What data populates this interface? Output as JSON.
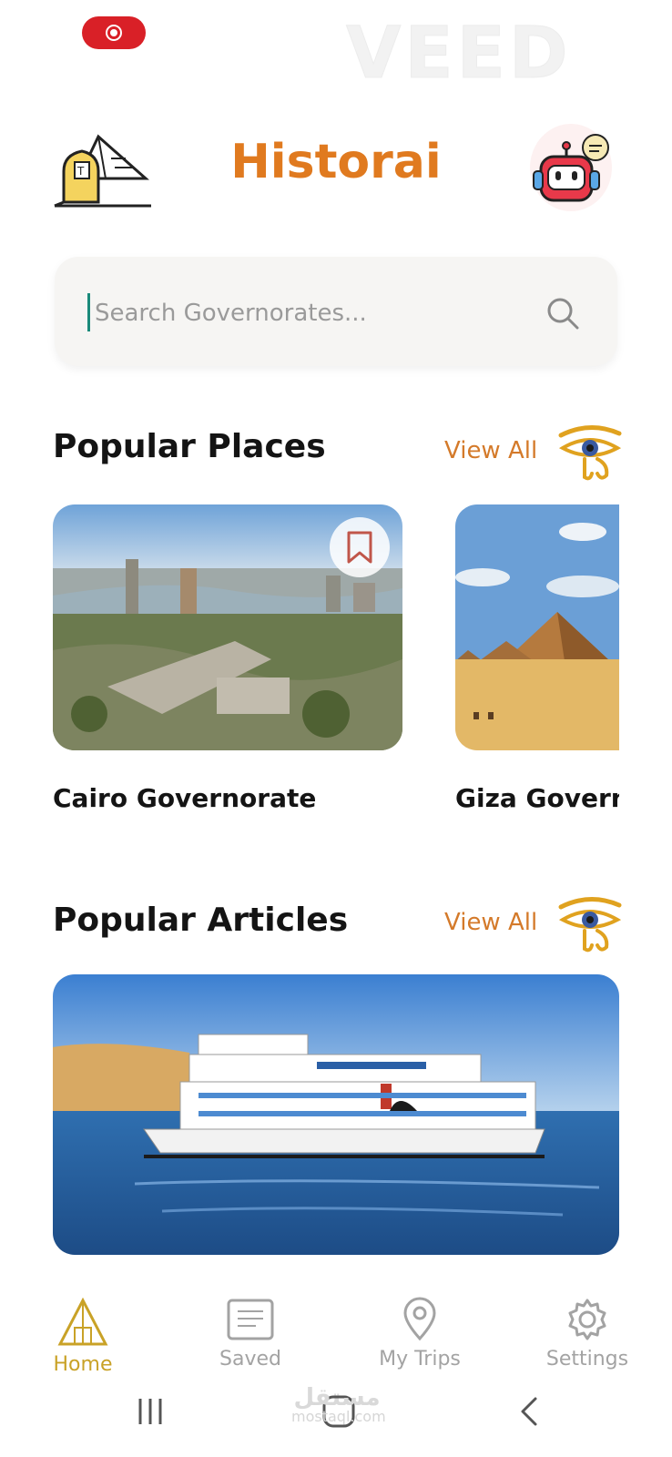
{
  "status": {
    "record_indicator": "recording",
    "watermark": "VEED"
  },
  "header": {
    "title": "Historai",
    "logo_icon": "pyramid-sphinx-icon",
    "assistant_icon": "robot-assistant-icon"
  },
  "search": {
    "placeholder": "Search Governorates..."
  },
  "popular_places": {
    "title": "Popular Places",
    "view_all": "View All",
    "items": [
      {
        "label": "Cairo Governorate",
        "bookmark_icon": "bookmark-icon"
      },
      {
        "label": "Giza Governorate"
      }
    ]
  },
  "popular_articles": {
    "title": "Popular Articles",
    "view_all": "View All"
  },
  "bottom_nav": {
    "items": [
      {
        "label": "Home",
        "icon": "home-pyramid-icon",
        "active": true
      },
      {
        "label": "Saved",
        "icon": "saved-icon",
        "active": false
      },
      {
        "label": "My Trips",
        "icon": "location-pin-icon",
        "active": false
      },
      {
        "label": "Settings",
        "icon": "gear-icon",
        "active": false
      }
    ]
  },
  "system_nav": {
    "recents": "recents-icon",
    "home": "home-icon",
    "back": "back-icon"
  },
  "watermark_bottom": {
    "arabic": "مستقل",
    "site": "mostaql.com"
  },
  "colors": {
    "accent": "#e07a1f",
    "active_nav": "#c9a227",
    "inactive_nav": "#a3a3a3"
  }
}
